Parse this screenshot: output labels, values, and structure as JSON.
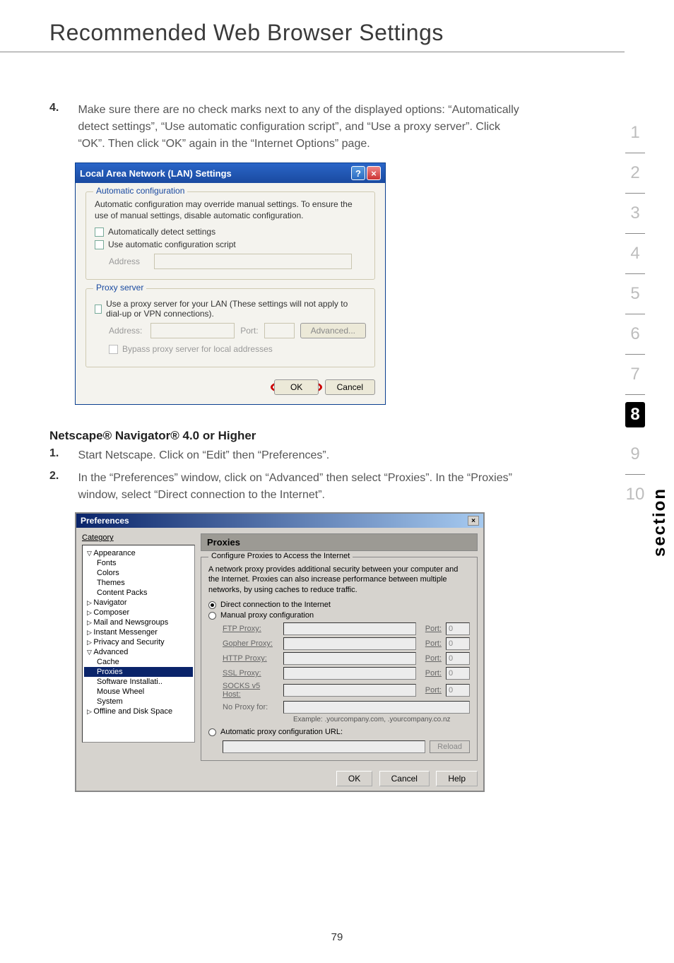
{
  "page": {
    "title": "Recommended Web Browser Settings",
    "number": "79",
    "sidebar_label": "section"
  },
  "nav": {
    "items": [
      "1",
      "2",
      "3",
      "4",
      "5",
      "6",
      "7",
      "8",
      "9",
      "10"
    ],
    "active_index": 7
  },
  "step4": {
    "num": "4.",
    "text": "Make sure there are no check marks next to any of the displayed options: “Automatically detect settings”, “Use automatic configuration script”, and “Use a proxy server”. Click “OK”. Then click “OK” again in the “Internet Options” page."
  },
  "lan_dialog": {
    "title": "Local Area Network (LAN) Settings",
    "help_btn": "?",
    "close_btn": "×",
    "auto_conf": {
      "legend": "Automatic configuration",
      "desc": "Automatic configuration may override manual settings.  To ensure the use of manual settings, disable automatic configuration.",
      "chk_detect": "Automatically detect settings",
      "chk_script": "Use automatic configuration script",
      "address_label": "Address"
    },
    "proxy": {
      "legend": "Proxy server",
      "chk_use": "Use a proxy server for your LAN (These settings will not apply to dial-up or VPN connections).",
      "address_label": "Address:",
      "port_label": "Port:",
      "advanced_btn": "Advanced...",
      "bypass": "Bypass proxy server for local addresses"
    },
    "ok_btn": "OK",
    "cancel_btn": "Cancel"
  },
  "netscape": {
    "heading": "Netscape® Navigator® 4.0 or Higher",
    "step1_num": "1.",
    "step1_text": "Start Netscape. Click on “Edit” then “Preferences”.",
    "step2_num": "2.",
    "step2_text": "In the “Preferences” window, click on “Advanced” then select “Proxies”. In the “Proxies” window, select “Direct connection to the Internet”."
  },
  "pref_dialog": {
    "title": "Preferences",
    "close": "×",
    "category_label": "Category",
    "tree": {
      "appearance": "Appearance",
      "fonts": "Fonts",
      "colors": "Colors",
      "themes": "Themes",
      "content_packs": "Content Packs",
      "navigator": "Navigator",
      "composer": "Composer",
      "mail_news": "Mail and Newsgroups",
      "instant": "Instant Messenger",
      "privacy": "Privacy and Security",
      "advanced": "Advanced",
      "cache": "Cache",
      "proxies": "Proxies",
      "software": "Software Installati..",
      "mouse": "Mouse Wheel",
      "system": "System",
      "offline": "Offline and Disk Space"
    },
    "panel_head": "Proxies",
    "fs_legend": "Configure Proxies to Access the Internet",
    "fs_desc": "A network proxy provides additional security between your computer and the Internet. Proxies can also increase performance between multiple networks, by using caches to reduce traffic.",
    "radio_direct": "Direct connection to the Internet",
    "radio_manual": "Manual proxy configuration",
    "labels": {
      "ftp": "FTP Proxy:",
      "gopher": "Gopher Proxy:",
      "http": "HTTP Proxy:",
      "ssl": "SSL Proxy:",
      "socks": "SOCKS v5 Host:",
      "noproxy": "No Proxy for:",
      "port": "Port:",
      "port_default": "0"
    },
    "example": "Example: .yourcompany.com, .yourcompany.co.nz",
    "radio_auto": "Automatic proxy configuration URL:",
    "reload_btn": "Reload",
    "ok": "OK",
    "cancel": "Cancel",
    "help": "Help"
  }
}
